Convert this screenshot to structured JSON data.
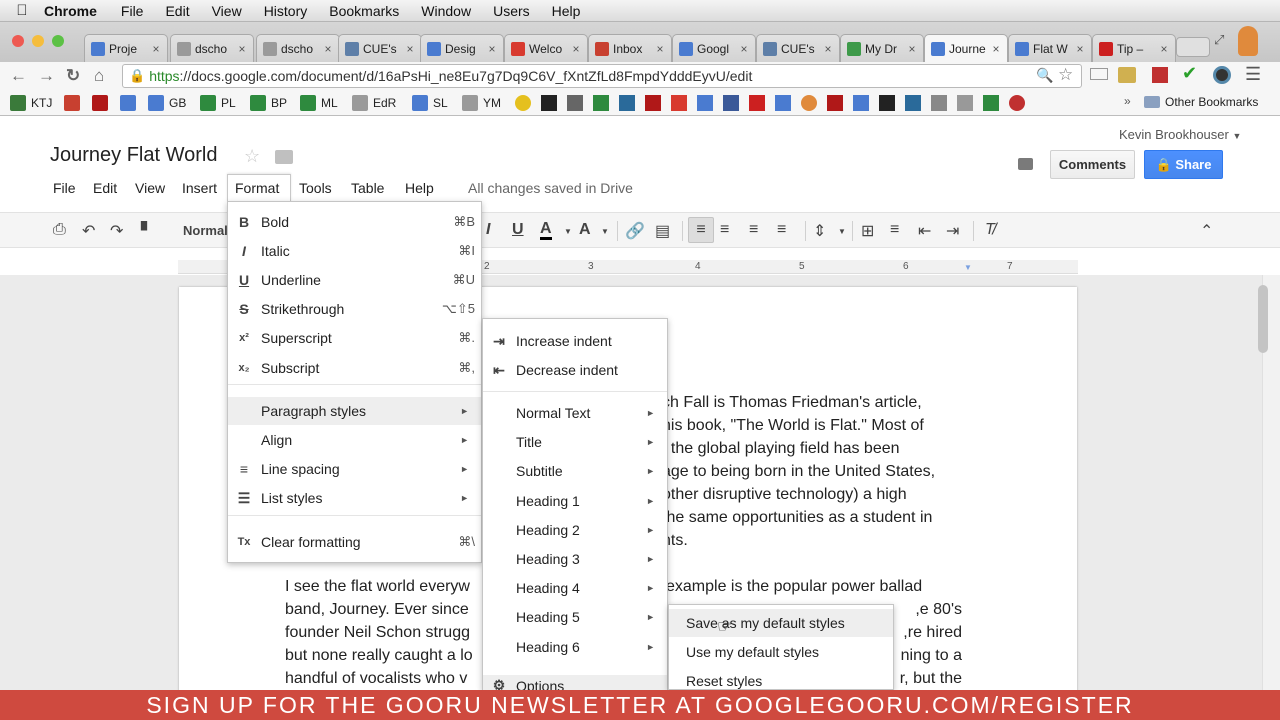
{
  "mac_menubar": {
    "app": "Chrome",
    "items": [
      "File",
      "Edit",
      "View",
      "History",
      "Bookmarks",
      "Window",
      "Users",
      "Help"
    ]
  },
  "tabs": [
    {
      "title": "Proje",
      "color": "#4a7bd0"
    },
    {
      "title": "dscho",
      "color": "#9a9a9a"
    },
    {
      "title": "dscho",
      "color": "#9a9a9a"
    },
    {
      "title": "CUE's",
      "color": "#5e7fa8"
    },
    {
      "title": "Desig",
      "color": "#4a7bd0"
    },
    {
      "title": "Welco",
      "color": "#d83a2f"
    },
    {
      "title": "Inbox",
      "color": "#c84030"
    },
    {
      "title": "Googl",
      "color": "#4a7bd0"
    },
    {
      "title": "CUE's",
      "color": "#5e7fa8"
    },
    {
      "title": "My Dr",
      "color": "#3e9a4a"
    },
    {
      "title": "Journe",
      "color": "#4a7bd0"
    },
    {
      "title": "Flat W",
      "color": "#4a7bd0"
    },
    {
      "title": "Tip –",
      "color": "#cc2020"
    }
  ],
  "omnibox": {
    "scheme": "https",
    "rest": "://docs.google.com/document/d/16aPsHi_ne8Eu7g7Dq9C6V_fXntZfLd8FmpdYdddEyvU/edit"
  },
  "bookmarks": [
    {
      "label": "KTJ",
      "color": "#3a7a3a"
    },
    {
      "label": "",
      "color": "#c84030"
    },
    {
      "label": "",
      "color": "#b01818"
    },
    {
      "label": "",
      "color": "#4a7bd0"
    },
    {
      "label": "GB",
      "color": "#4a7bd0"
    },
    {
      "label": "PL",
      "color": "#2e8a3e"
    },
    {
      "label": "BP",
      "color": "#2e8a3e"
    },
    {
      "label": "ML",
      "color": "#2e8a3e"
    },
    {
      "label": "EdR",
      "color": "#9a9a9a"
    },
    {
      "label": "SL",
      "color": "#4a7bd0"
    },
    {
      "label": "YM",
      "color": "#9a9a9a"
    }
  ],
  "bookmarks_other": "Other Bookmarks",
  "docs": {
    "title": "Journey Flat World",
    "user": "Kevin Brookhouser",
    "comments_label": "Comments",
    "share_label": "Share",
    "menu": [
      "File",
      "Edit",
      "View",
      "Insert",
      "Format",
      "Tools",
      "Table",
      "Help"
    ],
    "saved_status": "All changes saved in Drive",
    "style_label": "Normal"
  },
  "ruler_numbers": [
    "2",
    "3",
    "4",
    "5",
    "6",
    "7"
  ],
  "body_lines_right": [
    "ch Fall is Thomas Friedman's article,",
    "his book, \"The World is Flat.\" Most of",
    ", the global playing field has been",
    "age to being born in the United States,",
    " other disruptive technology) a high",
    "the same opportunities as a student in",
    "nts."
  ],
  "body_lines_left": [
    "I see the flat world everyw",
    "band, Journey. Ever since",
    "founder Neil Schon strugg",
    "but none really caught a lo",
    "handful of vocalists who v"
  ],
  "body_lines_right2": [
    "example is the popular power ballad",
    "e 80's,",
    "re hired,",
    "ning to a",
    "r, but the"
  ],
  "format_menu": [
    {
      "icon": "B",
      "label": "Bold",
      "shortcut": "⌘B"
    },
    {
      "icon": "I",
      "label": "Italic",
      "shortcut": "⌘I"
    },
    {
      "icon": "U",
      "label": "Underline",
      "shortcut": "⌘U"
    },
    {
      "icon": "S",
      "label": "Strikethrough",
      "shortcut": "⌥⇧5"
    },
    {
      "icon": "x²",
      "label": "Superscript",
      "shortcut": "⌘."
    },
    {
      "icon": "x₂",
      "label": "Subscript",
      "shortcut": "⌘,"
    },
    {
      "icon": "",
      "label": "Paragraph styles",
      "shortcut": ""
    },
    {
      "icon": "",
      "label": "Align",
      "shortcut": ""
    },
    {
      "icon": "≡",
      "label": "Line spacing",
      "shortcut": ""
    },
    {
      "icon": "☰",
      "label": "List styles",
      "shortcut": ""
    },
    {
      "icon": "Tx",
      "label": "Clear formatting",
      "shortcut": "⌘\\"
    }
  ],
  "para_menu": {
    "indent": [
      "Increase indent",
      "Decrease indent"
    ],
    "styles": [
      "Normal Text",
      "Title",
      "Subtitle",
      "Heading 1",
      "Heading 2",
      "Heading 3",
      "Heading 4",
      "Heading 5",
      "Heading 6"
    ],
    "options": "Options"
  },
  "options_menu": [
    "Save as my default styles",
    "Use my default styles",
    "Reset styles"
  ],
  "banner": "SIGN UP FOR THE GOORU NEWSLETTER AT GOOGLEGOORU.COM/REGISTER"
}
